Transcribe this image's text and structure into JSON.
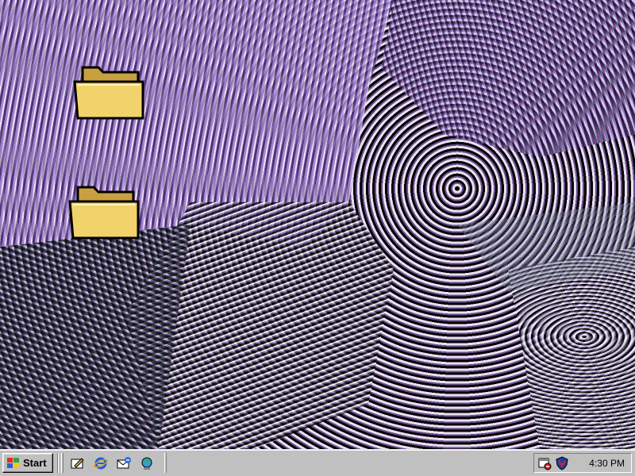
{
  "desktop": {
    "icons": [
      {
        "name": "folder-icon-1",
        "label": ""
      },
      {
        "name": "folder-icon-2",
        "label": ""
      }
    ]
  },
  "taskbar": {
    "start_label": "Start",
    "quick_launch": [
      "show-desktop-icon",
      "internet-explorer-icon",
      "outlook-express-icon",
      "channels-icon"
    ],
    "tray_icons": [
      "scheduler-icon",
      "antivirus-shield-icon"
    ],
    "clock": "4:30 PM"
  },
  "colors": {
    "taskbar": "#c0c0c0",
    "folder": "#f2d36b",
    "folder_dark": "#c9a040",
    "wallpaper_base": "#5b4478"
  }
}
